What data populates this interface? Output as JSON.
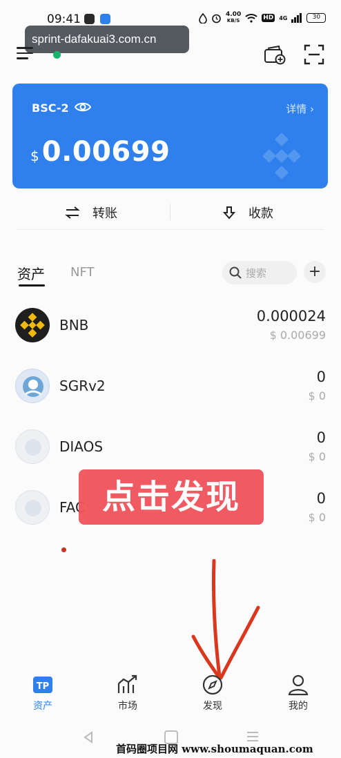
{
  "status_bar": {
    "time": "09:41",
    "net_speed_value": "4.00",
    "net_speed_unit": "KB/S",
    "hd_badge": "HD",
    "signal_badge": "4G",
    "battery": "30"
  },
  "url_overlay": "sprint-dafakuai3.com.cn",
  "wallet_card": {
    "chain": "BSC-2",
    "details_link": "详情 ›",
    "currency_symbol": "$",
    "balance": "0.00699",
    "color": "#2f80ed"
  },
  "actions": {
    "transfer_label": "转账",
    "receive_label": "收款"
  },
  "tabs": {
    "assets": "资产",
    "nft": "NFT"
  },
  "search": {
    "placeholder": "搜索"
  },
  "add_token_label": "+",
  "tokens": [
    {
      "name": "BNB",
      "amount": "0.000024",
      "value": "$ 0.00699"
    },
    {
      "name": "SGRv2",
      "amount": "0",
      "value": "$ 0"
    },
    {
      "name": "DIAOS",
      "amount": "0",
      "value": "$ 0"
    },
    {
      "name": "FAC",
      "amount": "0",
      "value": "$ 0"
    }
  ],
  "annotation": {
    "banner": "点击发现",
    "banner_color": "#f0525a",
    "arrow_color": "#d9381e"
  },
  "bottom_nav": {
    "items": [
      {
        "label": "资产",
        "icon": "tp-wallet-icon",
        "active": true
      },
      {
        "label": "市场",
        "icon": "market-chart-icon",
        "active": false
      },
      {
        "label": "发现",
        "icon": "compass-icon",
        "active": false
      },
      {
        "label": "我的",
        "icon": "profile-icon",
        "active": false
      }
    ]
  },
  "watermark": "首码圈项目网 www.shoumaquan.com"
}
